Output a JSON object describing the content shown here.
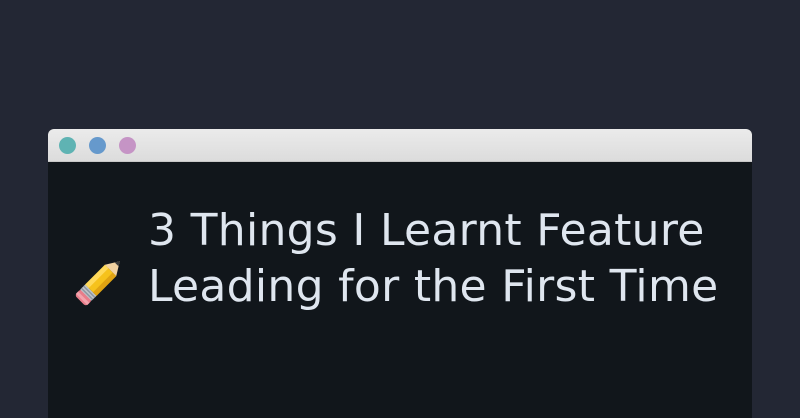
{
  "window": {
    "controls": [
      {
        "name": "close",
        "color": "#5fb3b3"
      },
      {
        "name": "minimize",
        "color": "#6699cc"
      },
      {
        "name": "maximize",
        "color": "#c594c5"
      }
    ]
  },
  "post": {
    "icon": "pencil-icon",
    "title": "3 Things I Learnt Feature Leading for the First Time"
  },
  "colors": {
    "page_background": "#232734",
    "window_background": "#11161b",
    "titlebar_background": "#e2e2e2",
    "title_text": "#dfe6ef"
  }
}
